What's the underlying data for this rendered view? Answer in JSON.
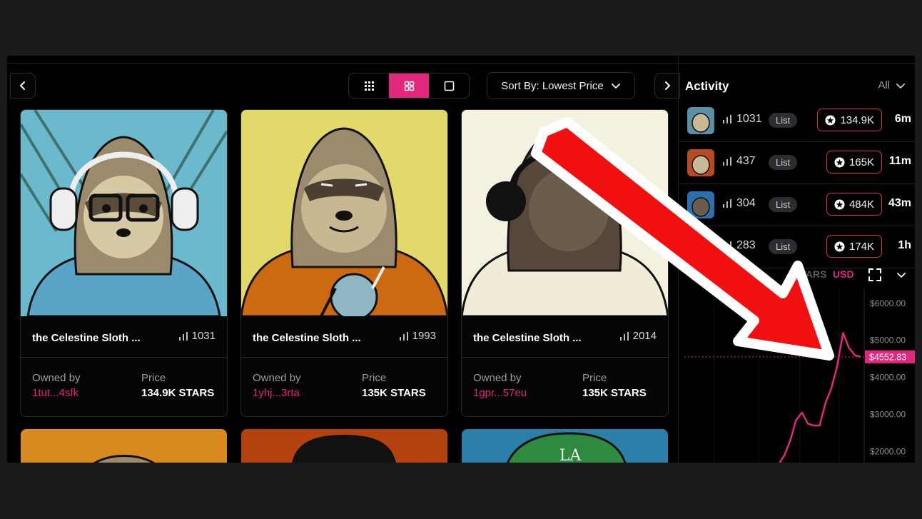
{
  "toolbar": {
    "sort_label": "Sort By: Lowest Price"
  },
  "cards": [
    {
      "title": "the Celestine Sloth ...",
      "rank": "1031",
      "owned_label": "Owned by",
      "owner": "1tut...4sfk",
      "price_label": "Price",
      "price": "134.9K STARS",
      "bg": "#6ab9cc",
      "shirt": "#5aa4c8"
    },
    {
      "title": "the Celestine Sloth ...",
      "rank": "1993",
      "owned_label": "Owned by",
      "owner": "1yhj...3rta",
      "price_label": "Price",
      "price": "135K STARS",
      "bg": "#e3d96a",
      "shirt": "#cc6a12"
    },
    {
      "title": "the Celestine Sloth ...",
      "rank": "2014",
      "owned_label": "Owned by",
      "owner": "1gpr...57eu",
      "price_label": "Price",
      "price": "135K STARS",
      "bg": "#f4f1df",
      "shirt": "#f0ecd8"
    }
  ],
  "bottom_tiles": [
    {
      "bg": "#d98a1e"
    },
    {
      "bg": "#b3420f"
    },
    {
      "bg": "#2a80a8",
      "cap_text": "LA"
    }
  ],
  "activity": {
    "title": "Activity",
    "filter": "All",
    "rows": [
      {
        "rank": "1031",
        "event": "List",
        "amount": "134.9K",
        "time": "6m",
        "thumb": "#5b8fa3"
      },
      {
        "rank": "437",
        "event": "List",
        "amount": "165K",
        "time": "11m",
        "thumb": "#b84a22"
      },
      {
        "rank": "304",
        "event": "List",
        "amount": "484K",
        "time": "43m",
        "thumb": "#2c6fb0"
      },
      {
        "rank": "283",
        "event": "List",
        "amount": "174K",
        "time": "1h",
        "thumb": "#3a86c8"
      }
    ]
  },
  "chart": {
    "currency_options": [
      "STARS",
      "USD"
    ],
    "selected_currency": "USD",
    "y_ticks": [
      "$6000.00",
      "$5000.00",
      "$4000.00",
      "$3000.00",
      "$2000.00"
    ],
    "current_label": "$4552.83",
    "accent": "#e0277c"
  },
  "chart_data": {
    "type": "line",
    "title": "",
    "xlabel": "",
    "ylabel": "",
    "ylim": [
      1700,
      6400
    ],
    "current_value": 4552.83,
    "values": [
      1650,
      1900,
      2300,
      2850,
      3050,
      2750,
      2700,
      2700,
      3300,
      3700,
      4300,
      5200,
      4800,
      4600,
      4552.83
    ]
  }
}
